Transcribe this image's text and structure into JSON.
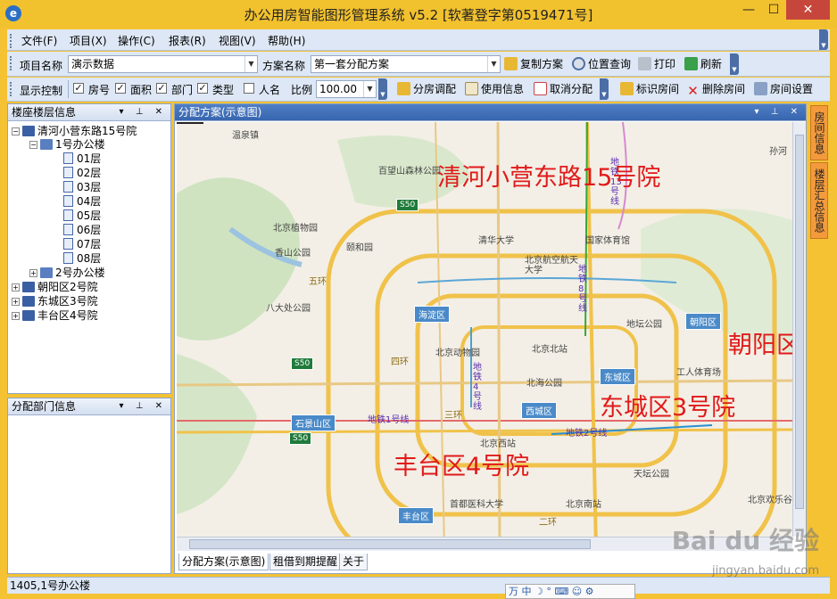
{
  "window": {
    "title": "办公用房智能图形管理系统 v5.2  [软著登字第0519471号]",
    "min_glyph": "—",
    "max_glyph": "☐",
    "close_glyph": "✕"
  },
  "menu": [
    "文件(F)",
    "项目(X)",
    "操作(C)",
    "报表(R)",
    "视图(V)",
    "帮助(H)"
  ],
  "toolbar1": {
    "project_label": "项目名称",
    "project_value": "演示数据",
    "plan_label": "方案名称",
    "plan_value": "第一套分配方案",
    "buttons": [
      "复制方案",
      "位置查询",
      "打印",
      "刷新"
    ]
  },
  "toolbar2": {
    "display_label": "显示控制",
    "checks": [
      {
        "label": "房号",
        "checked": true
      },
      {
        "label": "面积",
        "checked": true
      },
      {
        "label": "部门",
        "checked": true
      },
      {
        "label": "类型",
        "checked": true
      },
      {
        "label": "人名",
        "checked": false
      }
    ],
    "scale_label": "比例",
    "scale_value": "100.00",
    "buttons_a": [
      "分房调配",
      "使用信息",
      "取消分配"
    ],
    "buttons_b": [
      "标识房间",
      "删除房间",
      "房间设置"
    ]
  },
  "tree_panel": {
    "title": "楼座楼层信息",
    "root": "清河小营东路15号院",
    "building1": "1号办公楼",
    "floors": [
      "01层",
      "02层",
      "03层",
      "04层",
      "05层",
      "06层",
      "07层",
      "08层"
    ],
    "building2": "2号办公楼",
    "others": [
      "朝阳区2号院",
      "东城区3号院",
      "丰台区4号院"
    ]
  },
  "dept_panel": {
    "title": "分配部门信息"
  },
  "map_panel": {
    "title": "分配方案(示意图)",
    "overlays": {
      "qinghe": "清河小营东路15号院",
      "chaoyang": "朝阳区",
      "dongcheng": "东城区3号院",
      "fengtai": "丰台区4号院"
    },
    "places": [
      "温泉镇",
      "百望山森林公园",
      "北京植物园",
      "颐和园",
      "香山公园",
      "八大处公园",
      "清华大学",
      "国家体育馆",
      "北京航空航天大学",
      "北京动物园",
      "北京北站",
      "地坛公园",
      "工人体育场",
      "北海公园",
      "北京西站",
      "天坛公园",
      "北京南站",
      "首都医科大学",
      "北京欢乐谷",
      "孙河"
    ],
    "districts": [
      "海淀区",
      "朝阳区",
      "东城区",
      "西城区",
      "石景山区",
      "丰台区"
    ],
    "shields": [
      "S50",
      "S50",
      "S50"
    ],
    "subway": [
      "地铁1号线",
      "地铁2号线",
      "地铁4号线",
      "地铁8号线",
      "地铁13号线"
    ],
    "rings": [
      "四环",
      "五环",
      "三环",
      "二环"
    ],
    "tabs": [
      "分配方案(示意图)",
      "租借到期提醒",
      "关于"
    ]
  },
  "right_tabs": [
    "房间信息",
    "楼层汇总信息"
  ],
  "status": {
    "text": "1405,1号办公楼"
  },
  "ime": {
    "text": "万 中 ☽ ° ⌨ ☺ ⚙"
  },
  "watermark": {
    "brand": "Bai du 经验",
    "url": "jingyan.baidu.com"
  },
  "colors": {
    "accent": "#f2c12e",
    "overlay_red": "#e11a1a",
    "bar": "#dde7f5"
  }
}
